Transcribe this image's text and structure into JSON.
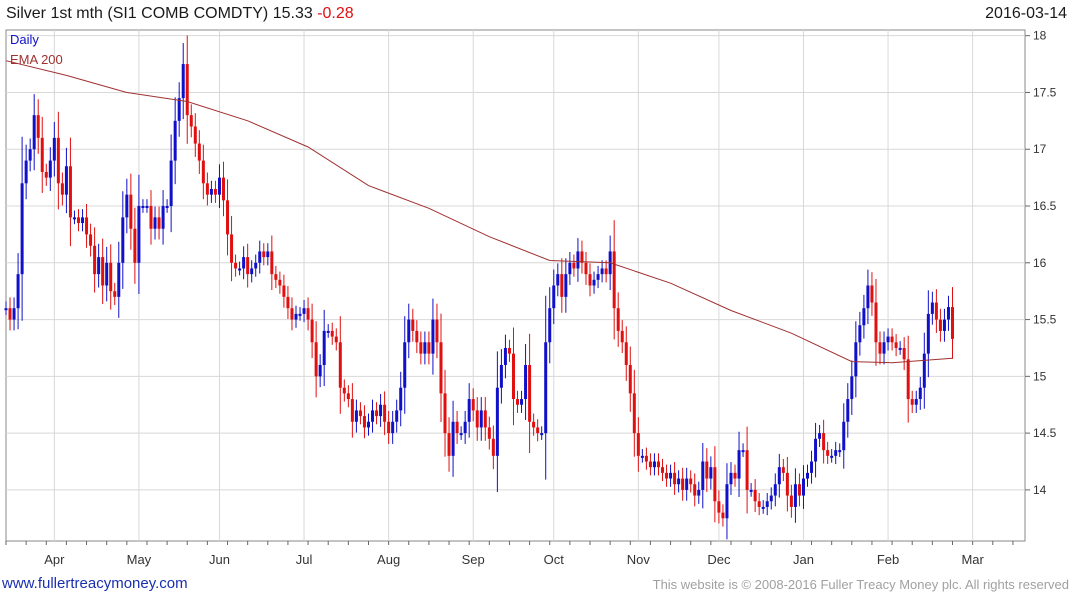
{
  "header": {
    "title": "Silver 1st mth (SI1 COMB COMDTY) 15.33",
    "change": "-0.28",
    "date": "2016-03-14"
  },
  "footer": {
    "site": "www.fullertreacymoney.com",
    "notice": "This website is © 2008-2016 Fuller Treacy Money plc. All rights reserved"
  },
  "colors": {
    "up": "#1010c8",
    "down": "#e01010",
    "ema": "#a03030",
    "grid": "#d8d8d8"
  },
  "chart_data": {
    "type": "line",
    "legend": [
      "Daily",
      "EMA 200"
    ],
    "legend_position": "top-left",
    "ylim": [
      13.55,
      18.05
    ],
    "yticks": [
      14,
      14.5,
      15,
      15.5,
      16,
      16.5,
      17,
      17.5,
      18
    ],
    "grid": true,
    "x_range": [
      0,
      253
    ],
    "xticks": [
      {
        "label": "Apr",
        "x": 12
      },
      {
        "label": "May",
        "x": 33
      },
      {
        "label": "Jun",
        "x": 53
      },
      {
        "label": "Jul",
        "x": 74
      },
      {
        "label": "Aug",
        "x": 95
      },
      {
        "label": "Sep",
        "x": 116
      },
      {
        "label": "Oct",
        "x": 136
      },
      {
        "label": "Nov",
        "x": 157
      },
      {
        "label": "Dec",
        "x": 177
      },
      {
        "label": "Jan",
        "x": 198
      },
      {
        "label": "Feb",
        "x": 219
      },
      {
        "label": "Mar",
        "x": 240
      }
    ],
    "series": [
      {
        "name": "Daily",
        "description": "approximate daily closes",
        "points": [
          [
            0,
            15.6
          ],
          [
            1,
            15.5
          ],
          [
            2,
            15.6
          ],
          [
            3,
            15.9
          ],
          [
            4,
            16.7
          ],
          [
            5,
            16.9
          ],
          [
            6,
            17.0
          ],
          [
            7,
            17.3
          ],
          [
            8,
            17.1
          ],
          [
            9,
            16.8
          ],
          [
            10,
            16.75
          ],
          [
            11,
            16.9
          ],
          [
            12,
            17.1
          ],
          [
            13,
            16.7
          ],
          [
            14,
            16.6
          ],
          [
            15,
            16.85
          ],
          [
            16,
            16.4
          ],
          [
            17,
            16.4
          ],
          [
            18,
            16.35
          ],
          [
            19,
            16.4
          ],
          [
            20,
            16.25
          ],
          [
            21,
            16.15
          ],
          [
            22,
            15.9
          ],
          [
            23,
            16.05
          ],
          [
            24,
            15.8
          ],
          [
            25,
            16.0
          ],
          [
            26,
            15.75
          ],
          [
            27,
            15.7
          ],
          [
            28,
            16.0
          ],
          [
            29,
            16.4
          ],
          [
            30,
            16.6
          ],
          [
            31,
            16.3
          ],
          [
            32,
            16.0
          ],
          [
            33,
            16.5
          ],
          [
            34,
            16.5
          ],
          [
            35,
            16.5
          ],
          [
            36,
            16.3
          ],
          [
            37,
            16.4
          ],
          [
            38,
            16.3
          ],
          [
            39,
            16.5
          ],
          [
            40,
            16.5
          ],
          [
            41,
            16.9
          ],
          [
            42,
            17.25
          ],
          [
            43,
            17.45
          ],
          [
            44,
            17.75
          ],
          [
            45,
            17.3
          ],
          [
            46,
            17.2
          ],
          [
            47,
            17.05
          ],
          [
            48,
            16.9
          ],
          [
            49,
            16.7
          ],
          [
            50,
            16.6
          ],
          [
            51,
            16.65
          ],
          [
            52,
            16.6
          ],
          [
            53,
            16.75
          ],
          [
            54,
            16.55
          ],
          [
            55,
            16.25
          ],
          [
            56,
            16.0
          ],
          [
            57,
            15.95
          ],
          [
            58,
            15.95
          ],
          [
            59,
            16.05
          ],
          [
            60,
            15.9
          ],
          [
            61,
            15.95
          ],
          [
            62,
            16.0
          ],
          [
            63,
            16.1
          ],
          [
            64,
            16.05
          ],
          [
            65,
            16.1
          ],
          [
            66,
            15.9
          ],
          [
            67,
            15.85
          ],
          [
            68,
            15.8
          ],
          [
            69,
            15.7
          ],
          [
            70,
            15.6
          ],
          [
            71,
            15.5
          ],
          [
            72,
            15.55
          ],
          [
            73,
            15.55
          ],
          [
            74,
            15.6
          ],
          [
            75,
            15.5
          ],
          [
            76,
            15.3
          ],
          [
            77,
            15.0
          ],
          [
            78,
            15.1
          ],
          [
            79,
            15.4
          ],
          [
            80,
            15.4
          ],
          [
            81,
            15.35
          ],
          [
            82,
            15.3
          ],
          [
            83,
            14.9
          ],
          [
            84,
            14.85
          ],
          [
            85,
            14.8
          ],
          [
            86,
            14.6
          ],
          [
            87,
            14.7
          ],
          [
            88,
            14.65
          ],
          [
            89,
            14.55
          ],
          [
            90,
            14.6
          ],
          [
            91,
            14.7
          ],
          [
            92,
            14.65
          ],
          [
            93,
            14.75
          ],
          [
            94,
            14.6
          ],
          [
            95,
            14.5
          ],
          [
            96,
            14.6
          ],
          [
            97,
            14.7
          ],
          [
            98,
            14.9
          ],
          [
            99,
            15.3
          ],
          [
            100,
            15.5
          ],
          [
            101,
            15.4
          ],
          [
            102,
            15.3
          ],
          [
            103,
            15.2
          ],
          [
            104,
            15.3
          ],
          [
            105,
            15.2
          ],
          [
            106,
            15.5
          ],
          [
            107,
            15.3
          ],
          [
            108,
            14.85
          ],
          [
            109,
            14.5
          ],
          [
            110,
            14.3
          ],
          [
            111,
            14.6
          ],
          [
            112,
            14.5
          ],
          [
            113,
            14.5
          ],
          [
            114,
            14.6
          ],
          [
            115,
            14.8
          ],
          [
            116,
            14.7
          ],
          [
            117,
            14.55
          ],
          [
            118,
            14.7
          ],
          [
            119,
            14.55
          ],
          [
            120,
            14.45
          ],
          [
            121,
            14.3
          ],
          [
            122,
            14.9
          ],
          [
            123,
            15.1
          ],
          [
            124,
            15.25
          ],
          [
            125,
            15.2
          ],
          [
            126,
            14.8
          ],
          [
            127,
            14.75
          ],
          [
            128,
            14.8
          ],
          [
            129,
            15.1
          ],
          [
            130,
            14.6
          ],
          [
            131,
            14.55
          ],
          [
            132,
            14.5
          ],
          [
            133,
            14.5
          ],
          [
            134,
            15.3
          ],
          [
            135,
            15.6
          ],
          [
            136,
            15.8
          ],
          [
            137,
            15.9
          ],
          [
            138,
            15.7
          ],
          [
            139,
            15.9
          ],
          [
            140,
            16.0
          ],
          [
            141,
            15.95
          ],
          [
            142,
            16.1
          ],
          [
            143,
            16.0
          ],
          [
            144,
            15.9
          ],
          [
            145,
            15.8
          ],
          [
            146,
            15.85
          ],
          [
            147,
            15.9
          ],
          [
            148,
            15.95
          ],
          [
            149,
            15.9
          ],
          [
            150,
            16.1
          ],
          [
            151,
            15.6
          ],
          [
            152,
            15.4
          ],
          [
            153,
            15.3
          ],
          [
            154,
            15.1
          ],
          [
            155,
            14.85
          ],
          [
            156,
            14.5
          ],
          [
            157,
            14.3
          ],
          [
            158,
            14.3
          ],
          [
            159,
            14.25
          ],
          [
            160,
            14.2
          ],
          [
            161,
            14.25
          ],
          [
            162,
            14.2
          ],
          [
            163,
            14.15
          ],
          [
            164,
            14.1
          ],
          [
            165,
            14.15
          ],
          [
            166,
            14.05
          ],
          [
            167,
            14.1
          ],
          [
            168,
            14.0
          ],
          [
            169,
            14.1
          ],
          [
            170,
            14.05
          ],
          [
            171,
            13.95
          ],
          [
            172,
            14.0
          ],
          [
            173,
            14.25
          ],
          [
            174,
            14.1
          ],
          [
            175,
            14.2
          ],
          [
            176,
            13.9
          ],
          [
            177,
            13.8
          ],
          [
            178,
            13.75
          ],
          [
            179,
            14.05
          ],
          [
            180,
            14.15
          ],
          [
            181,
            14.1
          ],
          [
            182,
            14.35
          ],
          [
            183,
            14.35
          ],
          [
            184,
            14.0
          ],
          [
            185,
            14.0
          ],
          [
            186,
            13.9
          ],
          [
            187,
            13.85
          ],
          [
            188,
            13.85
          ],
          [
            189,
            13.9
          ],
          [
            190,
            13.95
          ],
          [
            191,
            14.05
          ],
          [
            192,
            14.2
          ],
          [
            193,
            14.15
          ],
          [
            194,
            13.95
          ],
          [
            195,
            13.85
          ],
          [
            196,
            14.05
          ],
          [
            197,
            13.95
          ],
          [
            198,
            14.1
          ],
          [
            199,
            14.15
          ],
          [
            200,
            14.25
          ],
          [
            201,
            14.45
          ],
          [
            202,
            14.5
          ],
          [
            203,
            14.35
          ],
          [
            204,
            14.3
          ],
          [
            205,
            14.3
          ],
          [
            206,
            14.35
          ],
          [
            207,
            14.35
          ],
          [
            208,
            14.6
          ],
          [
            209,
            14.8
          ],
          [
            210,
            15.0
          ],
          [
            211,
            15.3
          ],
          [
            212,
            15.45
          ],
          [
            213,
            15.6
          ],
          [
            214,
            15.8
          ],
          [
            215,
            15.65
          ],
          [
            216,
            15.3
          ],
          [
            217,
            15.2
          ],
          [
            218,
            15.3
          ],
          [
            219,
            15.35
          ],
          [
            220,
            15.3
          ],
          [
            221,
            15.25
          ],
          [
            222,
            15.25
          ],
          [
            223,
            15.15
          ],
          [
            224,
            14.8
          ],
          [
            225,
            14.75
          ],
          [
            226,
            14.8
          ],
          [
            227,
            14.9
          ],
          [
            228,
            15.2
          ],
          [
            229,
            15.55
          ],
          [
            230,
            15.65
          ],
          [
            231,
            15.5
          ],
          [
            232,
            15.4
          ],
          [
            233,
            15.5
          ],
          [
            234,
            15.61
          ],
          [
            235,
            15.33
          ]
        ]
      },
      {
        "name": "EMA 200",
        "points": [
          [
            0,
            17.78
          ],
          [
            15,
            17.65
          ],
          [
            30,
            17.5
          ],
          [
            45,
            17.42
          ],
          [
            60,
            17.25
          ],
          [
            75,
            17.02
          ],
          [
            90,
            16.68
          ],
          [
            105,
            16.48
          ],
          [
            120,
            16.23
          ],
          [
            135,
            16.02
          ],
          [
            150,
            16.0
          ],
          [
            165,
            15.82
          ],
          [
            180,
            15.58
          ],
          [
            195,
            15.38
          ],
          [
            210,
            15.13
          ],
          [
            220,
            15.12
          ],
          [
            235,
            15.16
          ]
        ]
      }
    ]
  }
}
